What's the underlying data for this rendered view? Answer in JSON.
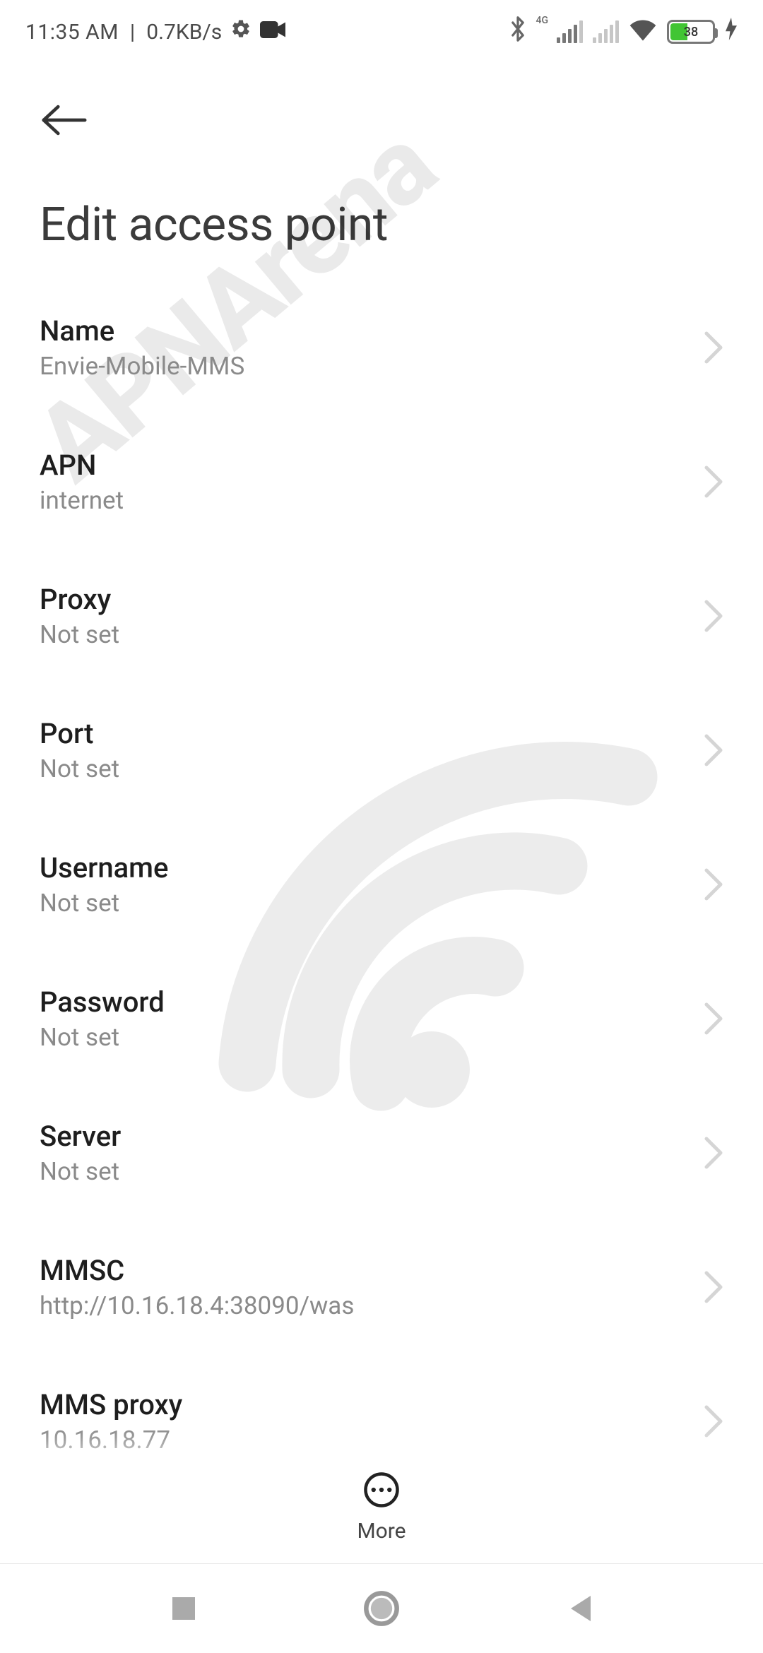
{
  "statusbar": {
    "time": "11:35 AM",
    "net_speed": "0.7KB/s",
    "battery_pct": "38",
    "signal_label": "4G"
  },
  "page": {
    "title": "Edit access point"
  },
  "settings": [
    {
      "label": "Name",
      "value": "Envie-Mobile-MMS"
    },
    {
      "label": "APN",
      "value": "internet"
    },
    {
      "label": "Proxy",
      "value": "Not set"
    },
    {
      "label": "Port",
      "value": "Not set"
    },
    {
      "label": "Username",
      "value": "Not set"
    },
    {
      "label": "Password",
      "value": "Not set"
    },
    {
      "label": "Server",
      "value": "Not set"
    },
    {
      "label": "MMSC",
      "value": "http://10.16.18.4:38090/was"
    },
    {
      "label": "MMS proxy",
      "value": "10.16.18.77"
    }
  ],
  "actions": {
    "more_label": "More"
  },
  "watermark": "APNArena"
}
